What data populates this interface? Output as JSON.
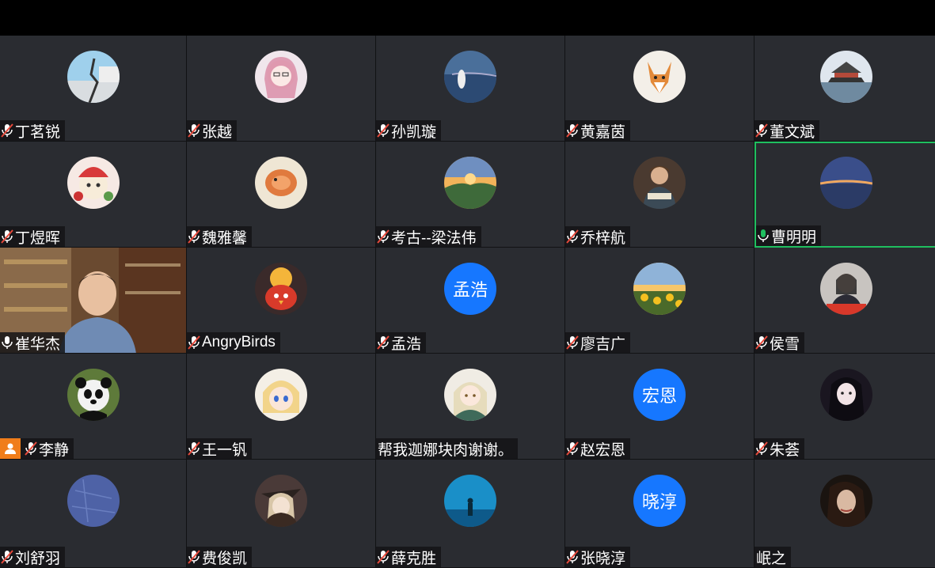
{
  "participants": [
    {
      "name": "丁茗锐",
      "mic": "muted"
    },
    {
      "name": "张越",
      "mic": "muted"
    },
    {
      "name": "孙凯璇",
      "mic": "muted"
    },
    {
      "name": "黄嘉茵",
      "mic": "muted"
    },
    {
      "name": "董文斌",
      "mic": "muted"
    },
    {
      "name": "丁煜晖",
      "mic": "muted"
    },
    {
      "name": "魏雅馨",
      "mic": "muted"
    },
    {
      "name": "考古--梁法伟",
      "mic": "muted"
    },
    {
      "name": "乔梓航",
      "mic": "muted"
    },
    {
      "name": "曹明明",
      "mic": "speaking"
    },
    {
      "name": "崔华杰",
      "mic": "on"
    },
    {
      "name": "AngryBirds",
      "mic": "muted"
    },
    {
      "name": "孟浩",
      "mic": "muted",
      "avatar_text": "孟浩"
    },
    {
      "name": "廖吉广",
      "mic": "muted"
    },
    {
      "name": "侯雪",
      "mic": "muted"
    },
    {
      "name": "李静",
      "mic": "muted"
    },
    {
      "name": "王一钒",
      "mic": "muted"
    },
    {
      "name": "帮我迦娜块肉谢谢。",
      "mic": "none"
    },
    {
      "name": "赵宏恩",
      "mic": "muted",
      "avatar_text": "宏恩"
    },
    {
      "name": "朱荟",
      "mic": "muted"
    },
    {
      "name": "刘舒羽",
      "mic": "muted"
    },
    {
      "name": "费俊凯",
      "mic": "muted"
    },
    {
      "name": "薛克胜",
      "mic": "muted"
    },
    {
      "name": "张晓淳",
      "mic": "muted",
      "avatar_text": "晓淳"
    },
    {
      "name": "岷之",
      "mic": "none"
    }
  ],
  "colors": {
    "tile_bg": "#2a2c31",
    "active_border": "#1fbf5f",
    "text_avatar_bg": "#1677ff",
    "host_badge": "#f07d1a"
  }
}
